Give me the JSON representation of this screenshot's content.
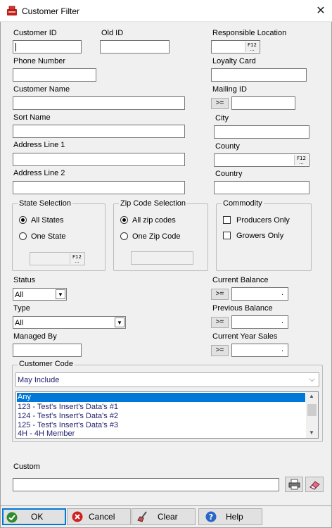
{
  "window": {
    "title": "Customer Filter",
    "close_glyph": "✕"
  },
  "fields": {
    "customer_id": "Customer ID",
    "old_id": "Old ID",
    "responsible_location": "Responsible Location",
    "phone_number": "Phone Number",
    "loyalty_card": "Loyalty Card",
    "customer_name": "Customer Name",
    "mailing_id": "Mailing ID",
    "sort_name": "Sort Name",
    "city": "City",
    "address_line_1": "Address Line 1",
    "county": "County",
    "address_line_2": "Address Line 2",
    "country": "Country"
  },
  "f12": {
    "label": "F12",
    "dots": "..."
  },
  "ge_button": ">=",
  "state_selection": {
    "title": "State Selection",
    "all": "All States",
    "one": "One State",
    "selected": "all"
  },
  "zip_selection": {
    "title": "Zip Code Selection",
    "all": "All zip codes",
    "one": "One Zip Code",
    "selected": "all"
  },
  "commodity": {
    "title": "Commodity",
    "producers": "Producers Only",
    "growers": "Growers Only"
  },
  "status": {
    "label": "Status",
    "value": "All"
  },
  "type": {
    "label": "Type",
    "value": "All"
  },
  "managed_by": {
    "label": "Managed By"
  },
  "current_balance": {
    "label": "Current Balance",
    "value": "."
  },
  "previous_balance": {
    "label": "Previous Balance",
    "value": "."
  },
  "current_year_sales": {
    "label": "Current Year Sales",
    "value": "."
  },
  "customer_code": {
    "title": "Customer Code",
    "mode": "May Include",
    "items": [
      "Any",
      "123 - Test's Insert's Data's #1",
      "124 - Test's Insert's Data's #2",
      "125 - Test's Insert's Data's #3",
      "4H - 4H Member"
    ],
    "selected_index": 0
  },
  "custom": {
    "label": "Custom"
  },
  "buttons": {
    "ok": "OK",
    "cancel": "Cancel",
    "clear": "Clear",
    "help": "Help"
  },
  "colors": {
    "accent": "#0078d7",
    "list_text": "#1e1e6e",
    "ok_icon": "#2e8b2e",
    "cancel_icon": "#d02020",
    "help_icon": "#2a66c8"
  }
}
